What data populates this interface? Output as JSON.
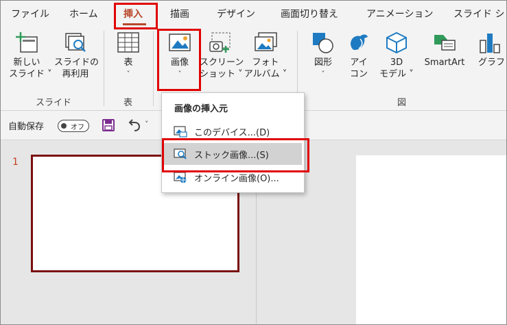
{
  "tabs": [
    {
      "label": "ファイル"
    },
    {
      "label": "ホーム"
    },
    {
      "label": "挿入"
    },
    {
      "label": "描画"
    },
    {
      "label": "デザイン"
    },
    {
      "label": "画面切り替え"
    },
    {
      "label": "アニメーション"
    },
    {
      "label": "スライド ショ"
    }
  ],
  "ribbon": {
    "new_slide": {
      "line1": "新しい",
      "line2": "スライド ˅"
    },
    "reuse_slide": {
      "line1": "スライドの",
      "line2": "再利用"
    },
    "slides_group": "スライド",
    "table": {
      "line1": "表",
      "line2": "˅"
    },
    "table_group": "表",
    "image": {
      "line1": "画像",
      "line2": "˅"
    },
    "screenshot": {
      "line1": "スクリーン",
      "line2": "ショット ˅"
    },
    "photo_album": {
      "line1": "フォト",
      "line2": "アルバム ˅"
    },
    "shapes": {
      "line1": "図形",
      "line2": "˅"
    },
    "icons": {
      "line1": "アイ",
      "line2": "コン"
    },
    "models3d": {
      "line1": "3D",
      "line2": "モデル ˅"
    },
    "smartart": {
      "line1": "SmartArt"
    },
    "graph": {
      "line1": "グラフ"
    },
    "illustrations_group": "図"
  },
  "qat": {
    "autosave_label": "自動保存",
    "autosave_state": "オフ"
  },
  "menu": {
    "title": "画像の挿入元",
    "items": [
      {
        "label": "このデバイス...(D)"
      },
      {
        "label": "ストック画像...(S)"
      },
      {
        "label": "オンライン画像(O)..."
      }
    ]
  },
  "slides": {
    "first_number": "1"
  },
  "colors": {
    "accent": "#b7472a",
    "highlight": "#e00000",
    "thumb_border": "#7a0e0e"
  }
}
